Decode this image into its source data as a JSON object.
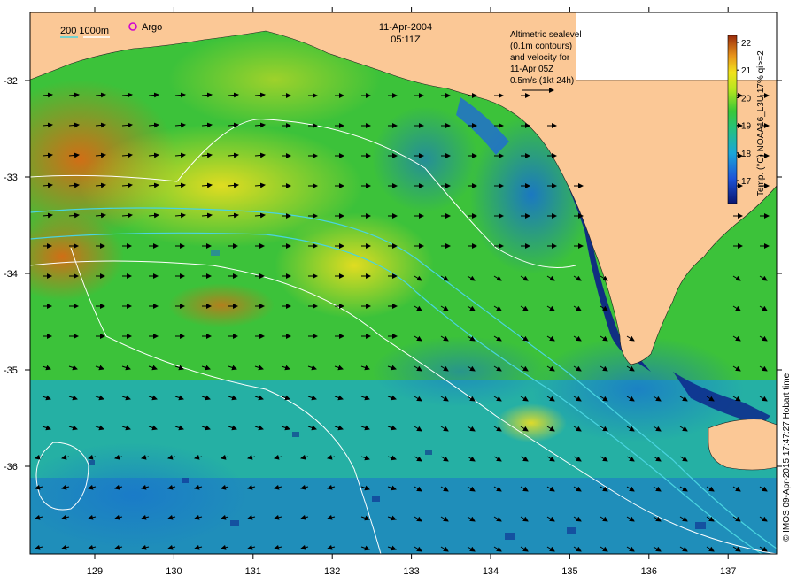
{
  "title": {
    "date": "11-Apr-2004",
    "time": "05:11Z"
  },
  "legend": {
    "isobath_label": "200  1000m",
    "argo_label": "Argo"
  },
  "note": {
    "lines": [
      "Altimetric sealevel",
      "(0.1m contours)",
      "and velocity for",
      "11-Apr 05Z",
      "0.5m/s (1kt 24h)"
    ]
  },
  "colorbar": {
    "label": "Temp. (°C) NOAA16_L3U 17% qi>=2",
    "ticks": [
      "22",
      "21",
      "20",
      "19",
      "18",
      "17"
    ]
  },
  "axes": {
    "x_ticks": [
      "129",
      "130",
      "131",
      "132",
      "133",
      "134",
      "135",
      "136",
      "137"
    ],
    "y_ticks": [
      "-32",
      "-33",
      "-34",
      "-35",
      "-36"
    ]
  },
  "credit": "© IMOS 09-Apr-2015 17:47:27 Hobart time",
  "colors": {
    "land": "#fbc896",
    "coast_ocean_dark": "#0b1f8a",
    "warm": "#e07a1a",
    "cool": "#1aa6d8"
  }
}
